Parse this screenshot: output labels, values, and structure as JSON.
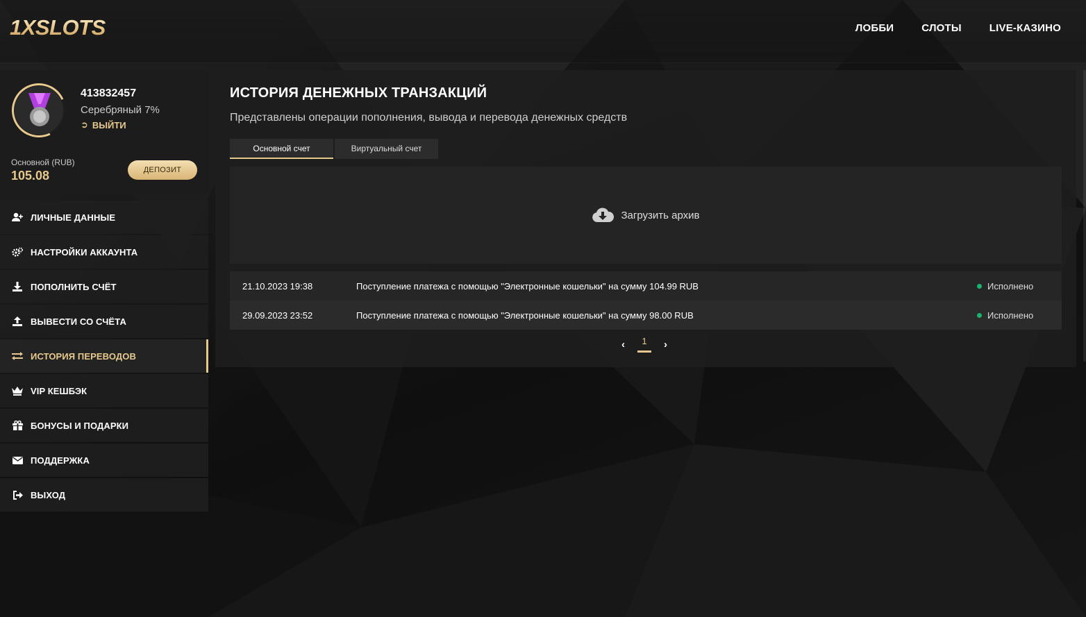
{
  "brand": {
    "logo": "1XSLOTS",
    "accent": "#e7c98e"
  },
  "nav": {
    "items": [
      "ЛОББИ",
      "СЛОТЫ",
      "LIVE-КАЗИНО"
    ]
  },
  "profile": {
    "user_id": "413832457",
    "level": "Серебряный 7%",
    "logout": "ВЫЙТИ",
    "balance_label": "Основной (RUB)",
    "balance": "105.08",
    "deposit_label": "ДЕПОЗИТ"
  },
  "menu": {
    "items": [
      {
        "label": "ЛИЧНЫЕ ДАННЫЕ",
        "icon": "user-plus-icon"
      },
      {
        "label": "НАСТРОЙКИ АККАУНТА",
        "icon": "gears-icon"
      },
      {
        "label": "ПОПОЛНИТЬ СЧЁТ",
        "icon": "download-icon"
      },
      {
        "label": "ВЫВЕСТИ СО СЧЁТА",
        "icon": "upload-icon"
      },
      {
        "label": "ИСТОРИЯ ПЕРЕВОДОВ",
        "icon": "exchange-icon",
        "active": true
      },
      {
        "label": "VIP КЕШБЭК",
        "icon": "crown-icon"
      },
      {
        "label": "БОНУСЫ И ПОДАРКИ",
        "icon": "gift-icon"
      },
      {
        "label": "ПОДДЕРЖКА",
        "icon": "envelope-icon"
      },
      {
        "label": "ВЫХОД",
        "icon": "sign-out-icon"
      }
    ]
  },
  "main": {
    "title": "ИСТОРИЯ ДЕНЕЖНЫХ ТРАНЗАКЦИЙ",
    "subtitle": "Представлены операции пополнения, вывода и перевода денежных средств",
    "tabs": [
      {
        "label": "Основной счет",
        "active": true
      },
      {
        "label": "Виртуальный счет",
        "active": false
      }
    ],
    "archive_label": "Загрузить архив",
    "transactions": [
      {
        "date": "21.10.2023 19:38",
        "description": "Поступление платежа с помощью \"Электронные кошельки\" на сумму 104.99 RUB",
        "status": "Исполнено"
      },
      {
        "date": "29.09.2023 23:52",
        "description": "Поступление платежа с помощью \"Электронные кошельки\" на сумму 98.00 RUB",
        "status": "Исполнено"
      }
    ],
    "pagination": {
      "current": "1",
      "prev": "‹",
      "next": "›"
    },
    "status_color": "#19b36b"
  }
}
